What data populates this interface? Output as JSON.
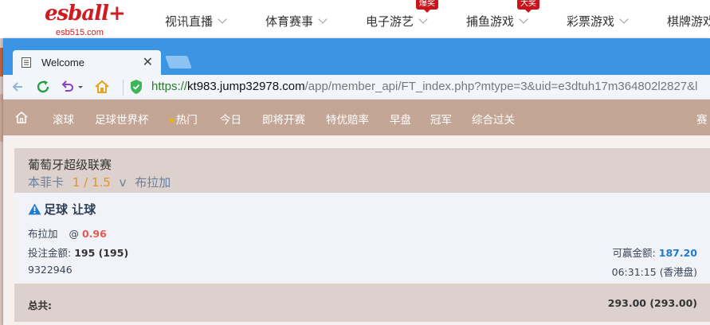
{
  "site": {
    "logo": "esball+",
    "logo_sub": "esb515.com",
    "nav": [
      {
        "label": "视讯直播",
        "badge": ""
      },
      {
        "label": "体育赛事",
        "badge": ""
      },
      {
        "label": "电子游艺",
        "badge": "爆奖"
      },
      {
        "label": "捕鱼游戏",
        "badge": "大奖"
      },
      {
        "label": "彩票游戏",
        "badge": ""
      },
      {
        "label": "棋牌游戏",
        "badge": ""
      }
    ]
  },
  "browser": {
    "tab_title": "Welcome",
    "url_scheme": "https://",
    "url_host": "kt983.jump32978.com",
    "url_path": "/app/member_api/FT_index.php?mtype=3&uid=e3dtuh17m364802l2827&l"
  },
  "menu": {
    "home_icon": "home-icon",
    "items": [
      "滚球",
      "足球世界杯",
      "热门",
      "今日",
      "即将开赛",
      "特优赔率",
      "早盘",
      "冠军",
      "综合过关",
      "赛"
    ]
  },
  "bet": {
    "league": "葡萄牙超级联赛",
    "home_team": "本菲卡",
    "handicap": "1 / 1.5",
    "vs": "v",
    "away_team": "布拉加",
    "title": "足球 让球",
    "selection": "布拉加",
    "odds_at": "@",
    "odds": "0.96",
    "stake_label": "投注金额:",
    "stake_value": "195 (195)",
    "win_label": "可赢金额:",
    "win_value": "187.20",
    "ticket_id": "9322946",
    "time": "06:31:15 (香港盘)",
    "total_label": "总共:",
    "total_value": "293.00 (293.00)"
  },
  "colors": {
    "brand_red": "#d01b22",
    "tab_blue": "#3b95e2",
    "menu_brown": "#c3a695",
    "odds_red": "#e05a50",
    "win_blue": "#1f7bd0",
    "handicap_orange": "#e89221"
  }
}
